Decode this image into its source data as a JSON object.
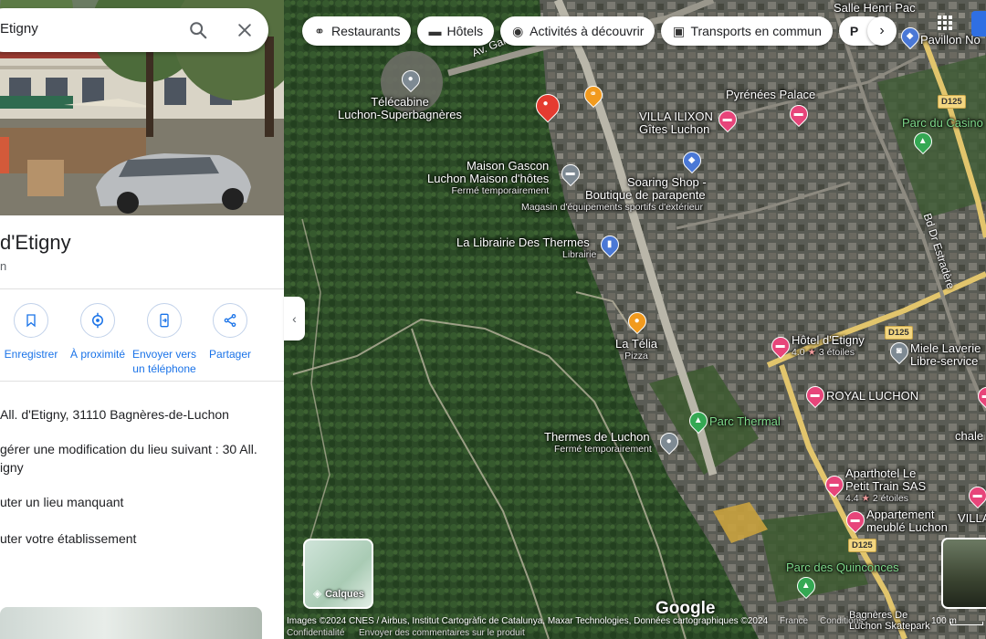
{
  "search": {
    "value": "Etigny"
  },
  "place": {
    "name": "d'Etigny",
    "subtitle": "n"
  },
  "actions": [
    {
      "label": "Enregistrer"
    },
    {
      "label": "À proximité"
    },
    {
      "label": "Envoyer vers un téléphone"
    },
    {
      "label": "Partager"
    }
  ],
  "info": {
    "address": "All. d'Etigny, 31110 Bagnères-de-Luchon",
    "suggest": "gérer une modification du lieu suivant : 30 All.",
    "suggest2": "igny",
    "add_place": "uter un lieu manquant",
    "add_business": "uter votre établissement"
  },
  "chips": [
    {
      "label": "Restaurants",
      "icon": "fork-knife-icon"
    },
    {
      "label": "Hôtels",
      "icon": "bed-icon"
    },
    {
      "label": "Activités à découvrir",
      "icon": "camera-icon"
    },
    {
      "label": "Transports en commun",
      "icon": "bus-icon"
    },
    {
      "label": "P",
      "icon": "parking-icon"
    }
  ],
  "map": {
    "pois": {
      "salle": "Salle Henri Pac",
      "pavillon": "Pavillon No",
      "telecabine1": "Télécabine",
      "telecabine2": "Luchon-Superbagnères",
      "pyrenees": "Pyrénées Palace",
      "villa1": "VILLA ILIXON",
      "villa2": "Gîtes Luchon",
      "casino": "Parc du Casino",
      "maison1": "Maison Gascon",
      "maison2": "Luchon Maison d'hôtes",
      "maison3": "Fermé temporairement",
      "soaring1": "Soaring Shop -",
      "soaring2": "Boutique de parapente",
      "soaring3": "Magasin d'équipements sportifs d'extérieur",
      "librairie1": "La Librairie Des Thermes",
      "librairie2": "Librairie",
      "telia1": "La Télia",
      "telia2": "Pizza",
      "hotel1": "Hôtel d'Etigny",
      "hotel2": "4.0",
      "hotel3": "3 étoiles",
      "miele1": "Miele Laverie",
      "miele2": "Libre-service",
      "royal": "ROYAL LUCHON",
      "thermal": "Parc Thermal",
      "thermes1": "Thermes de Luchon",
      "thermes2": "Fermé temporairement",
      "chale": "chale",
      "apart1": "Aparthotel Le",
      "apart2": "Petit Train SAS",
      "apart3": "4.4",
      "apart4": "2 étoiles",
      "app1": "Appartement",
      "app2": "meublé Luchon",
      "villa": "VILLA",
      "quinconces": "Parc des Quinconces",
      "bagneres1": "Bagnères De",
      "bagneres2": "Luchon Skatepark"
    },
    "roads": {
      "galieni": "Av. Gallieni",
      "estradere": "Bd Dr Estradère",
      "d125a": "D125",
      "d125b": "D125",
      "d125c": "D125"
    }
  },
  "layers": {
    "label": "Calques"
  },
  "google": "Google",
  "footer": {
    "attribution": "Images ©2024 CNES / Airbus, Institut Cartogràfic de Catalunya, Maxar Technologies, Données cartographiques ©2024",
    "privacy": "Confidentialité",
    "feedback": "Envoyer des commentaires sur le produit",
    "country": "France",
    "conditions": "Conditions",
    "scale": "100 m"
  },
  "colors": {
    "accent": "#1a73e8",
    "hotel_pin": "#e7457a",
    "selected_pin": "#e53b30",
    "park_label": "#7ed98a"
  }
}
